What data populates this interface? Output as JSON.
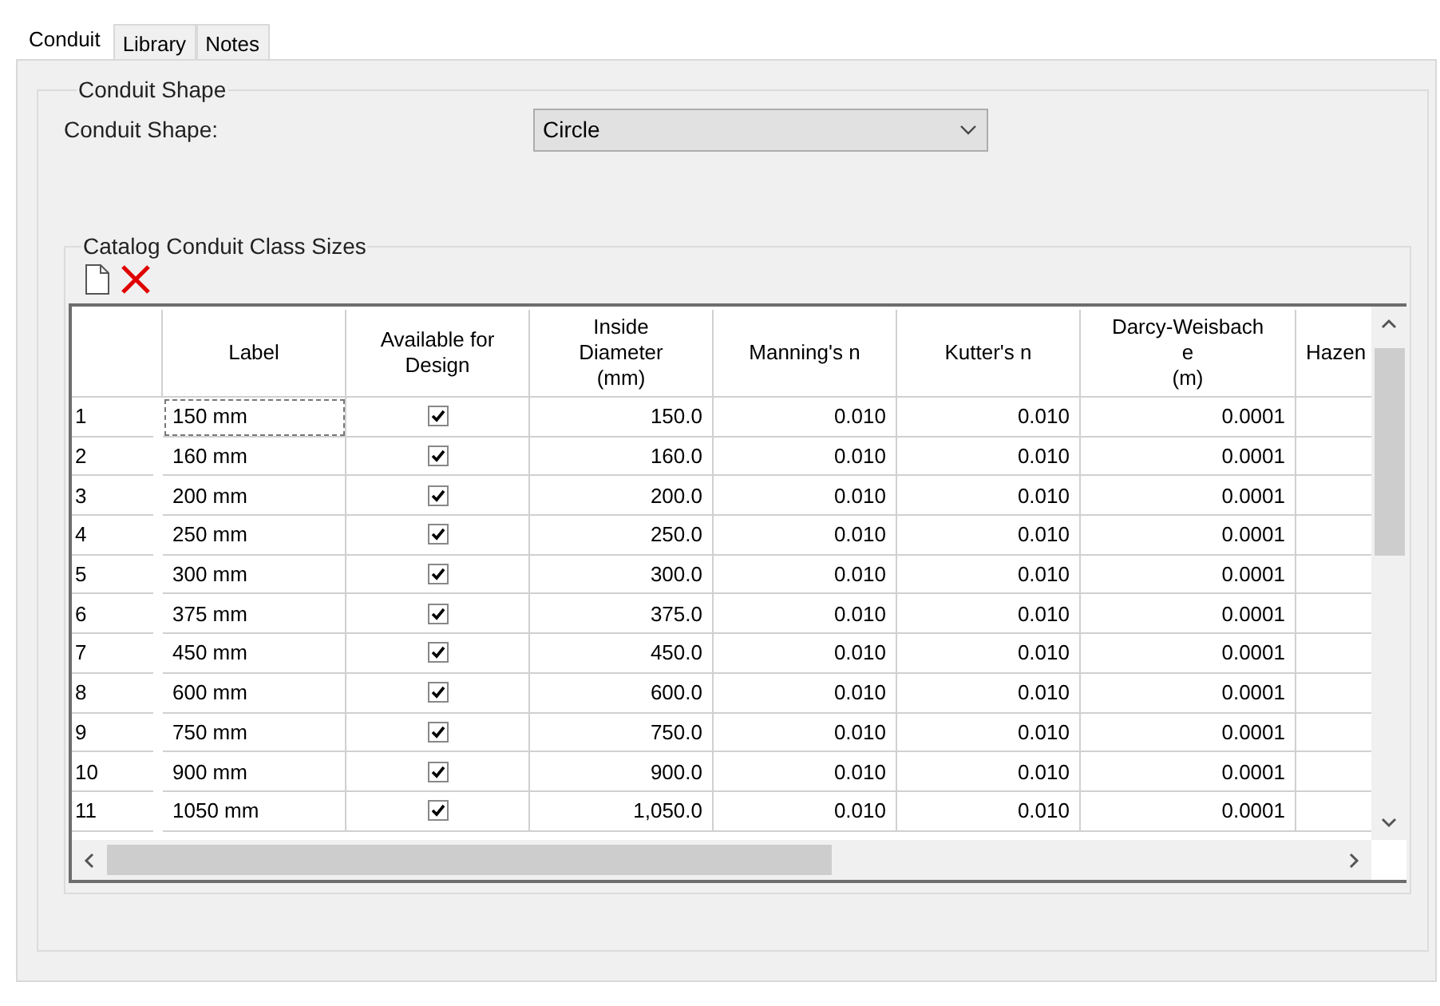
{
  "tabs": [
    {
      "label": "Conduit",
      "selected": true
    },
    {
      "label": "Library",
      "selected": false
    },
    {
      "label": "Notes",
      "selected": false
    }
  ],
  "shape_group": {
    "title": "Conduit Shape",
    "label": "Conduit Shape:",
    "dropdown": {
      "value": "Circle"
    }
  },
  "catalog_group": {
    "title": "Catalog Conduit Class Sizes"
  },
  "table": {
    "columns": [
      "",
      "Label",
      "Available for Design",
      "Inside\nDiameter\n(mm)",
      "Manning's n",
      "Kutter's n",
      "Darcy-Weisbach\ne\n(m)",
      "Hazen"
    ],
    "rows": [
      {
        "index": "1",
        "label": "150 mm",
        "checked": true,
        "focused": true,
        "diameter": "150.0",
        "manning": "0.010",
        "kutter": "0.010",
        "darcy": "0.0001"
      },
      {
        "index": "2",
        "label": "160 mm",
        "checked": true,
        "focused": false,
        "diameter": "160.0",
        "manning": "0.010",
        "kutter": "0.010",
        "darcy": "0.0001"
      },
      {
        "index": "3",
        "label": "200 mm",
        "checked": true,
        "focused": false,
        "diameter": "200.0",
        "manning": "0.010",
        "kutter": "0.010",
        "darcy": "0.0001"
      },
      {
        "index": "4",
        "label": "250 mm",
        "checked": true,
        "focused": false,
        "diameter": "250.0",
        "manning": "0.010",
        "kutter": "0.010",
        "darcy": "0.0001"
      },
      {
        "index": "5",
        "label": "300 mm",
        "checked": true,
        "focused": false,
        "diameter": "300.0",
        "manning": "0.010",
        "kutter": "0.010",
        "darcy": "0.0001"
      },
      {
        "index": "6",
        "label": "375 mm",
        "checked": true,
        "focused": false,
        "diameter": "375.0",
        "manning": "0.010",
        "kutter": "0.010",
        "darcy": "0.0001"
      },
      {
        "index": "7",
        "label": "450 mm",
        "checked": true,
        "focused": false,
        "diameter": "450.0",
        "manning": "0.010",
        "kutter": "0.010",
        "darcy": "0.0001"
      },
      {
        "index": "8",
        "label": "600 mm",
        "checked": true,
        "focused": false,
        "diameter": "600.0",
        "manning": "0.010",
        "kutter": "0.010",
        "darcy": "0.0001"
      },
      {
        "index": "9",
        "label": "750 mm",
        "checked": true,
        "focused": false,
        "diameter": "750.0",
        "manning": "0.010",
        "kutter": "0.010",
        "darcy": "0.0001"
      },
      {
        "index": "10",
        "label": "900 mm",
        "checked": true,
        "focused": false,
        "diameter": "900.0",
        "manning": "0.010",
        "kutter": "0.010",
        "darcy": "0.0001"
      },
      {
        "index": "11",
        "label": "1050 mm",
        "checked": true,
        "focused": false,
        "diameter": "1,050.0",
        "manning": "0.010",
        "kutter": "0.010",
        "darcy": "0.0001"
      }
    ]
  }
}
